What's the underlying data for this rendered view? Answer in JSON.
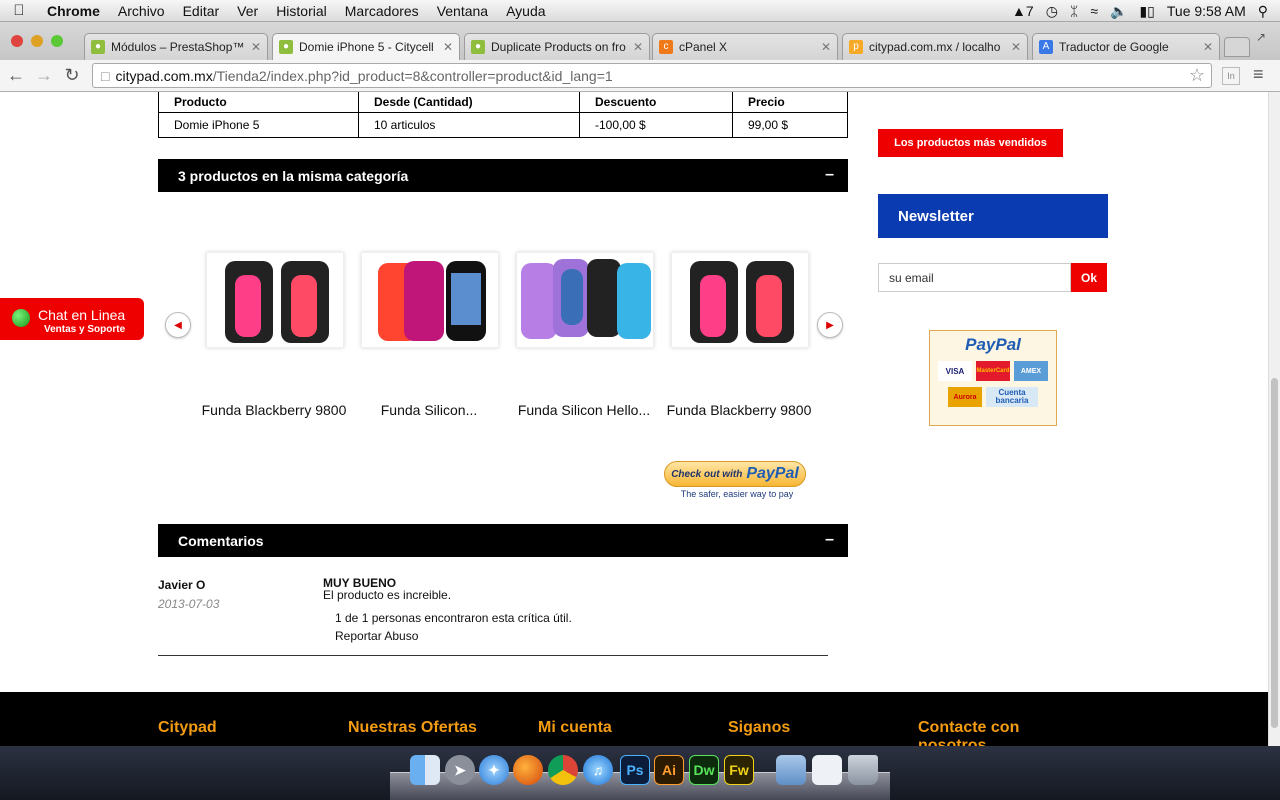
{
  "menubar": {
    "app": "Chrome",
    "items": [
      "Archivo",
      "Editar",
      "Ver",
      "Historial",
      "Marcadores",
      "Ventana",
      "Ayuda"
    ],
    "status_adobe": "7",
    "clock": "Tue 9:58 AM"
  },
  "tabs": [
    {
      "title": "Módulos – PrestaShop™",
      "favicon": "prestashop-icon"
    },
    {
      "title": "Domie iPhone 5 - Citycell",
      "favicon": "prestashop-icon",
      "active": true
    },
    {
      "title": "Duplicate Products on fro",
      "favicon": "prestashop-icon"
    },
    {
      "title": "cPanel X",
      "favicon": "cpanel-icon"
    },
    {
      "title": "citypad.com.mx / localho",
      "favicon": "phpmyadmin-icon"
    },
    {
      "title": "Traductor de Google",
      "favicon": "google-translate-icon"
    }
  ],
  "address": {
    "host": "citypad.com.mx",
    "path": "/Tienda2/index.php?id_product=8&controller=product&id_lang=1"
  },
  "discount_table": {
    "headers": [
      "Producto",
      "Desde (Cantidad)",
      "Descuento",
      "Precio"
    ],
    "rows": [
      [
        "Domie iPhone 5",
        "10 articulos",
        "-100,00 $",
        "99,00 $"
      ]
    ]
  },
  "same_category": {
    "title": "3 productos en la misma categoría",
    "toggle": "–",
    "products": [
      {
        "name": "Funda Blackberry 9800"
      },
      {
        "name": "Funda Silicon..."
      },
      {
        "name": "Funda Silicon Hello..."
      },
      {
        "name": "Funda Blackberry 9800"
      }
    ]
  },
  "paypal_checkout": {
    "button_small": "Check out with",
    "button_brand": "PayPal",
    "tagline": "The safer, easier way to pay"
  },
  "comments": {
    "title": "Comentarios",
    "toggle": "–",
    "review": {
      "author": "Javier O",
      "date": "2013-07-03",
      "title": "MUY BUENO",
      "body": "El producto es increible.",
      "useful": "1 de 1 personas encontraron esta crítica útil.",
      "report": "Reportar Abuso"
    }
  },
  "sidebar": {
    "bestsellers": "Los productos más vendidos",
    "newsletter": "Newsletter",
    "email_value": "su email",
    "ok": "Ok",
    "paypal_logo": "PayPal",
    "cards": [
      "VISA",
      "MasterCard",
      "AMEX"
    ],
    "aurora": "Aurora",
    "bank": "Cuenta bancaria"
  },
  "chat": {
    "title": "Chat en Linea",
    "subtitle": "Ventas y Soporte"
  },
  "footer": {
    "columns": [
      "Citypad",
      "Nuestras Ofertas",
      "Mi cuenta",
      "Siganos",
      "Contacte con nosotros"
    ]
  },
  "dock": {
    "icons": [
      "finder-icon",
      "launchpad-icon",
      "safari-icon",
      "firefox-icon",
      "chrome-icon",
      "itunes-icon",
      "photoshop-icon",
      "illustrator-icon",
      "dreamweaver-icon",
      "fireworks-icon",
      "folder-icon",
      "preview-icon",
      "trash-icon"
    ],
    "labels": {
      "ps": "Ps",
      "ai": "Ai",
      "dw": "Dw",
      "fw": "Fw"
    }
  },
  "colors": {
    "accent_red": "#ee0000",
    "newsletter_blue": "#0b3bb0",
    "footer_orange": "#f39c12"
  }
}
